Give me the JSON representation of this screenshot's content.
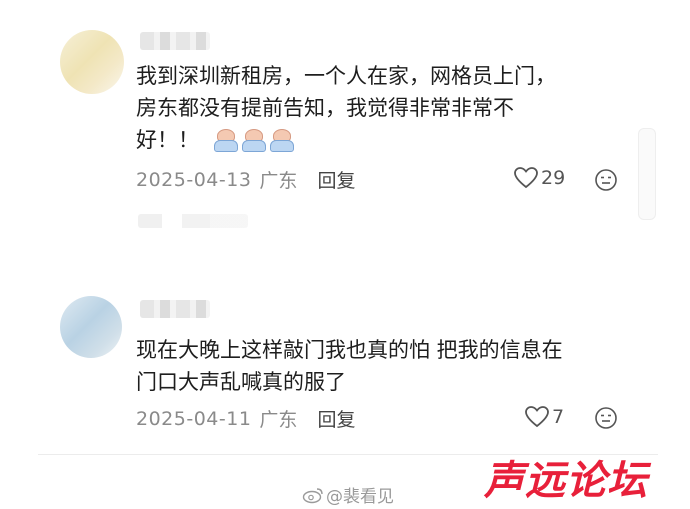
{
  "comments": [
    {
      "text_lines": [
        "我到深圳新租房，一个人在家，网格员上门，",
        "房东都没有提前告知，我觉得非常非常不",
        "好！！"
      ],
      "emoji_count": 3,
      "date": "2025-04-13",
      "region": "广东",
      "reply_label": "回复",
      "likes": "29"
    },
    {
      "text_lines": [
        "现在大晚上这样敲门我也真的怕 把我的信息在",
        "门口大声乱喊真的服了"
      ],
      "date": "2025-04-11",
      "region": "广东",
      "reply_label": "回复",
      "likes": "7"
    }
  ],
  "watermark": "@裴看见",
  "brand": "声远论坛",
  "colors": {
    "brand": "#e8203a",
    "meta": "#8a8a8a",
    "text": "#1e1e1e"
  },
  "icons": [
    "heart-outline-icon",
    "emoji-reaction-icon",
    "weibo-icon"
  ]
}
